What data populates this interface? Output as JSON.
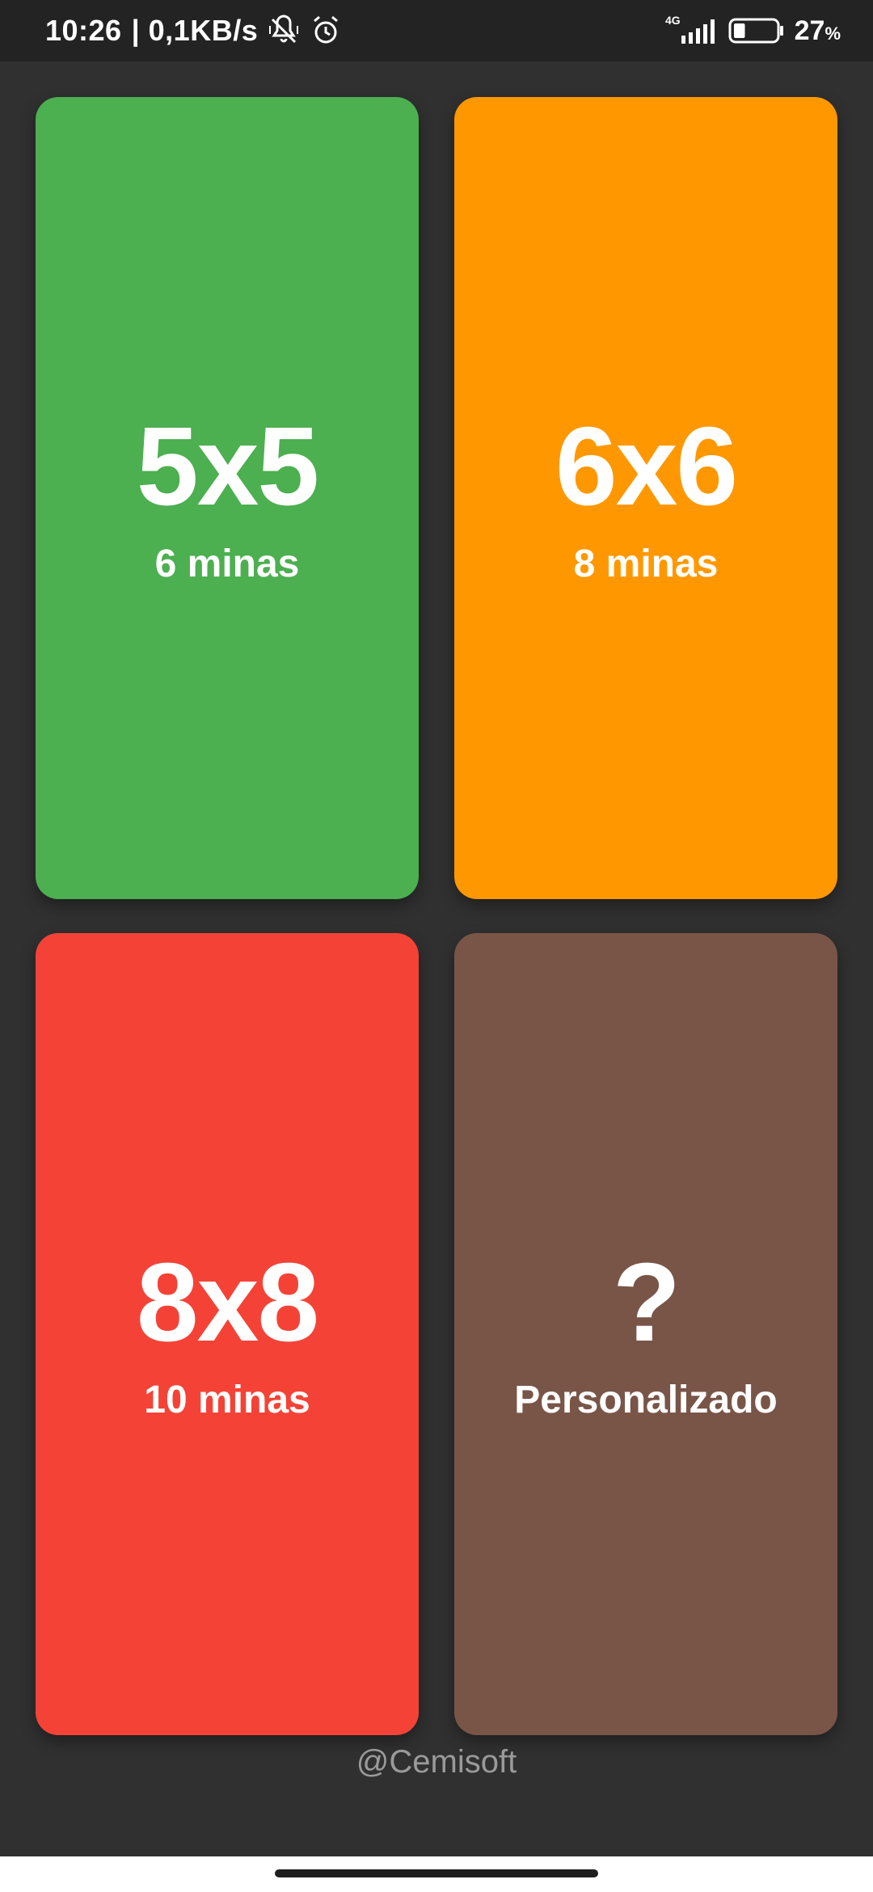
{
  "status_bar": {
    "time": "10:26",
    "network_speed": "| 0,1KB/s",
    "network_type": "4G",
    "battery_percent": "27",
    "battery_unit": "%",
    "battery_level": 0.27,
    "icons": [
      "vibrate-off-icon",
      "alarm-icon",
      "signal-icon",
      "battery-icon"
    ]
  },
  "cards": [
    {
      "size": "5x5",
      "subtitle": "6 minas",
      "color": "#4CAF50"
    },
    {
      "size": "6x6",
      "subtitle": "8 minas",
      "color": "#FF9800"
    },
    {
      "size": "8x8",
      "subtitle": "10 minas",
      "color": "#F44336"
    },
    {
      "size": "?",
      "subtitle": "Personalizado",
      "color": "#795548"
    }
  ],
  "footer": {
    "credit": "@Cemisoft"
  },
  "colors": {
    "background": "#303030",
    "status_bar": "#232323"
  }
}
